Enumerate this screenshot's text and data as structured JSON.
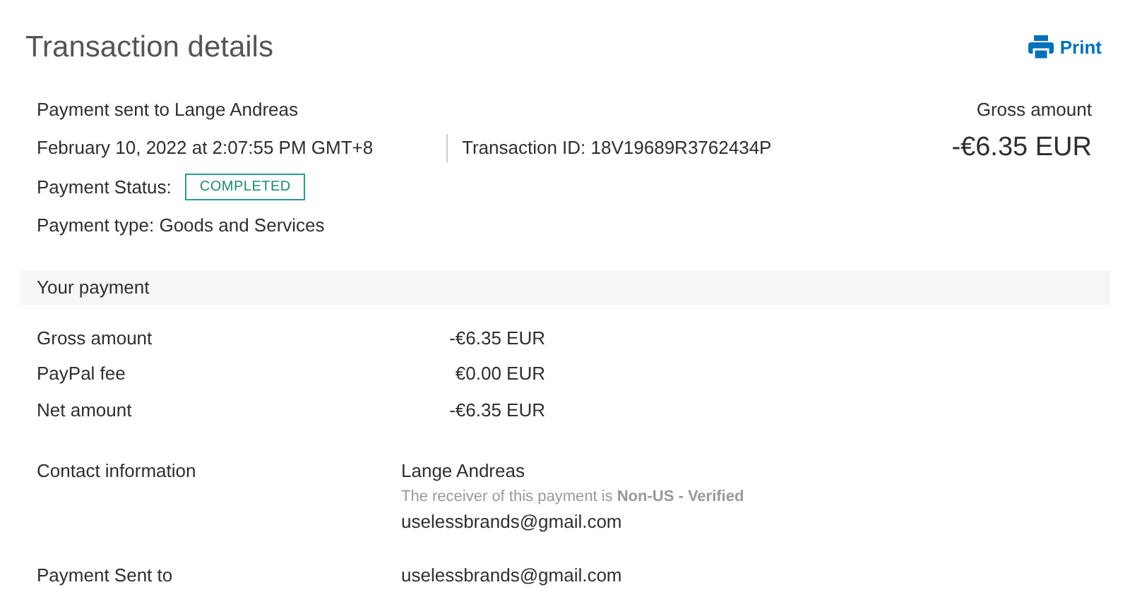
{
  "title": "Transaction details",
  "print_button": "Print",
  "summary": {
    "recipient": "Payment sent to Lange Andreas",
    "date": "February 10, 2022 at 2:07:55 PM GMT+8",
    "transaction_id": "Transaction ID: 18V19689R3762434P",
    "status_label": "Payment Status:",
    "status": "COMPLETED",
    "payment_type": "Payment type: Goods and Services",
    "gross_label": "Gross amount",
    "gross_value": "-€6.35 EUR"
  },
  "section_title": "Your payment",
  "amounts": [
    {
      "label": "Gross amount",
      "value": "-€6.35 EUR"
    },
    {
      "label": "PayPal fee",
      "value": "€0.00 EUR"
    },
    {
      "label": "Net amount",
      "value": "-€6.35 EUR"
    }
  ],
  "contact": {
    "label": "Contact information",
    "name": "Lange Andreas",
    "note": "The receiver of this payment is **Non-US - Verified**",
    "email": "uselessbrands@gmail.com"
  },
  "sent_to": {
    "label": "Payment Sent to",
    "value": "uselessbrands@gmail.com"
  }
}
